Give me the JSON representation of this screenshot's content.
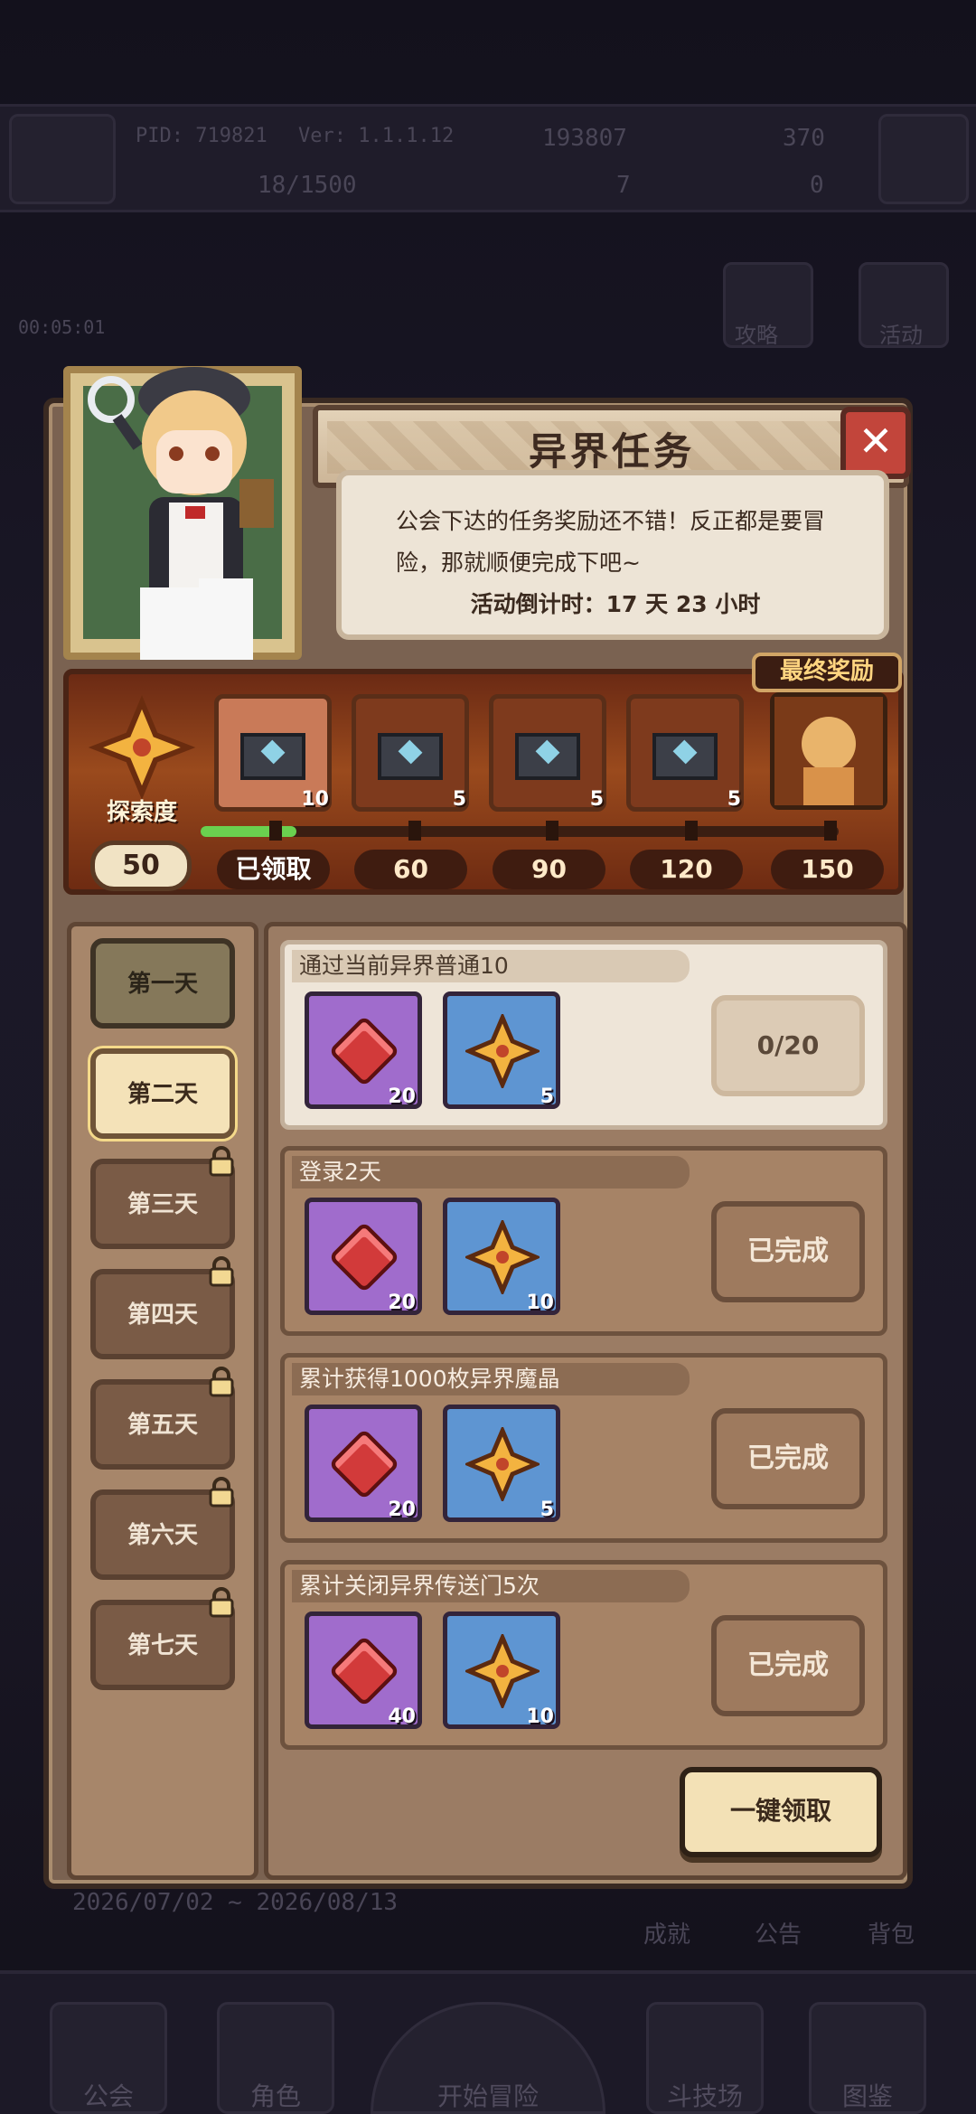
{
  "topbar": {
    "pid": "PID: 719821",
    "ver": "Ver: 1.1.1.12",
    "gold": "193807",
    "gems": "370",
    "exp": "18/1500",
    "clover": "7",
    "other": "0",
    "timer": "00:05:01",
    "guide": "攻略",
    "activity": "活动",
    "date_range": "2026/07/02 ~ 2026/08/13",
    "achievement": "成就",
    "notice": "公告",
    "bag": "背包"
  },
  "bottom_nav": {
    "guild": "公会",
    "role": "角色",
    "adventure": "开始冒险",
    "arena": "斗技场",
    "atlas": "图鉴"
  },
  "panel": {
    "title": "异界任务",
    "description": "公会下达的任务奖励还不错！反正都是要冒险，那就顺便完成下吧~",
    "countdown": "活动倒计时：17 天 23 小时",
    "final_reward_label": "最终奖励",
    "explore_label": "探索度",
    "explore_value": "50",
    "progress_fraction": 0.15,
    "chests": [
      {
        "count": "10",
        "claimed": true,
        "icon": "envelope-icon"
      },
      {
        "count": "5",
        "claimed": false,
        "icon": "envelope-icon"
      },
      {
        "count": "5",
        "claimed": false,
        "icon": "envelope-icon"
      },
      {
        "count": "5",
        "claimed": false,
        "icon": "envelope-icon"
      }
    ],
    "milestones": [
      "已领取",
      "60",
      "90",
      "120",
      "150"
    ],
    "days": [
      {
        "label": "第一天",
        "state": "done"
      },
      {
        "label": "第二天",
        "state": "active"
      },
      {
        "label": "第三天",
        "state": "locked"
      },
      {
        "label": "第四天",
        "state": "locked"
      },
      {
        "label": "第五天",
        "state": "locked"
      },
      {
        "label": "第六天",
        "state": "locked"
      },
      {
        "label": "第七天",
        "state": "locked"
      }
    ],
    "tasks": [
      {
        "name": "通过当前异界普通10",
        "gem_count": "20",
        "clover_count": "5",
        "status": "0/20",
        "state": "pending"
      },
      {
        "name": "登录2天",
        "gem_count": "20",
        "clover_count": "10",
        "status": "已完成",
        "state": "complete"
      },
      {
        "name": "累计获得1000枚异界魔晶",
        "gem_count": "20",
        "clover_count": "5",
        "status": "已完成",
        "state": "complete"
      },
      {
        "name": "累计关闭异界传送门5次",
        "gem_count": "40",
        "clover_count": "10",
        "status": "已完成",
        "state": "complete"
      }
    ],
    "claim_all": "一键领取"
  },
  "colors": {
    "accent_green": "#6ad04f",
    "close_red": "#c2453b",
    "gem_red": "#d23a3a",
    "panel_brown": "#7a6251"
  }
}
